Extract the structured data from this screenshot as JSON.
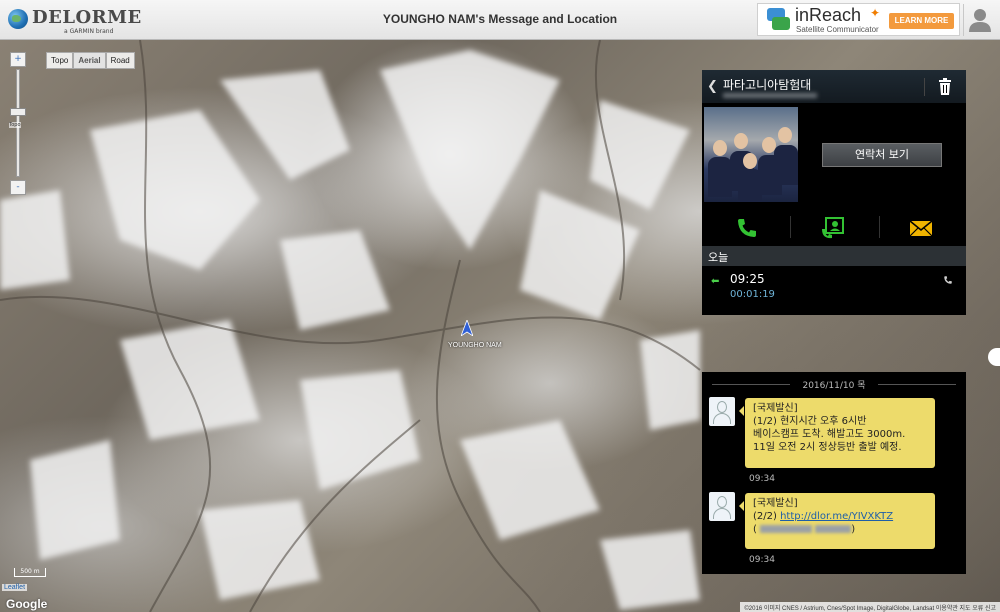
{
  "header": {
    "logo_text": "DELORME",
    "logo_sub": "a GARMIN brand",
    "title": "YOUNGHO NAM's Message and Location",
    "banner": {
      "brand": "inReach",
      "subtitle": "Satellite Communicator",
      "button": "LEARN MORE"
    },
    "user_icon": "user-icon"
  },
  "map": {
    "types": [
      "Topo",
      "Aerial",
      "Road"
    ],
    "active_type": "Aerial",
    "zoom_in": "+",
    "zoom_out": "-",
    "zoom_level_label": "Topo",
    "marker_label": "YOUNGHO NAM",
    "scale": "500 m",
    "leaflet": "Leaflet",
    "google": "Google",
    "attribution": "©2016 이미지 CNES / Astrium, Cnes/Spot Image, DigitalGlobe, Landsat   이용약관   지도 오류 신고"
  },
  "phone": {
    "contact_name": "파타고니아탐험대",
    "contact_button": "연락처 보기",
    "today_label": "오늘",
    "call": {
      "time": "09:25",
      "duration": "00:01:19"
    },
    "icons": {
      "back": "back-icon",
      "trash": "trash-icon",
      "call": "phone-icon",
      "contact": "contact-card-icon",
      "message": "envelope-icon"
    }
  },
  "chat": {
    "date": "2016/11/10 목",
    "messages": [
      {
        "line1": "[국제발신]",
        "line2": "(1/2) 현지시간 오후 6시반",
        "line3": "베이스캠프 도착. 해발고도 3000m.",
        "line4": "11일 오전 2시 정상등반 출발 예정.",
        "time": "09:34"
      },
      {
        "line1": "[국제발신]",
        "line2_prefix": "(2/2) ",
        "link": "http://dlor.me/YIVXKTZ",
        "line3_prefix": "(",
        "line3_suffix": ")",
        "time": "09:34"
      }
    ]
  },
  "colors": {
    "bubble": "#eddb6b",
    "learn_more": "#f39a3d",
    "call_green": "#4bd14b",
    "envelope": "#f0b400",
    "link": "#1f5fa8"
  }
}
